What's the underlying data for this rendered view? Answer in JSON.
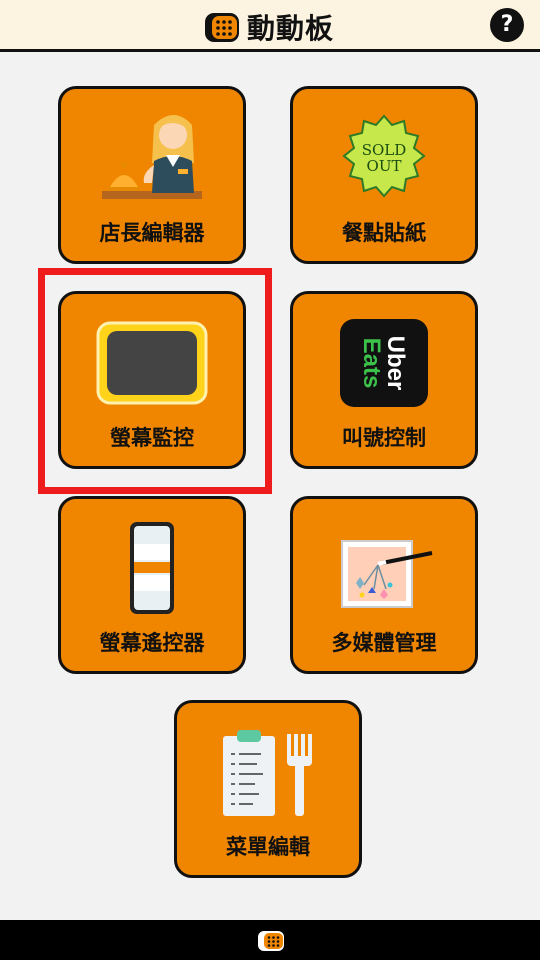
{
  "header": {
    "title": "動動板",
    "help_label": "?"
  },
  "tiles": [
    {
      "label": "店長編輯器",
      "icon": "shopkeeper-icon"
    },
    {
      "label": "餐點貼紙",
      "icon": "sold-out-sticker-icon",
      "sticker_text_1": "SOLD",
      "sticker_text_2": "OUT"
    },
    {
      "label": "螢幕監控",
      "icon": "screen-monitor-icon"
    },
    {
      "label": "叫號控制",
      "icon": "uber-eats-icon",
      "brand_text_1": "Uber",
      "brand_text_2": "Eats"
    },
    {
      "label": "螢幕遙控器",
      "icon": "phone-remote-icon"
    },
    {
      "label": "多媒體管理",
      "icon": "media-picture-icon"
    },
    {
      "label": "菜單編輯",
      "icon": "menu-clipboard-fork-icon"
    }
  ],
  "selected_tile": "螢幕監控",
  "colors": {
    "tile": "#f08600",
    "highlight": "#ee1c1c",
    "header_bg": "#fdf3e1",
    "page_bg": "#f2f2f2"
  }
}
